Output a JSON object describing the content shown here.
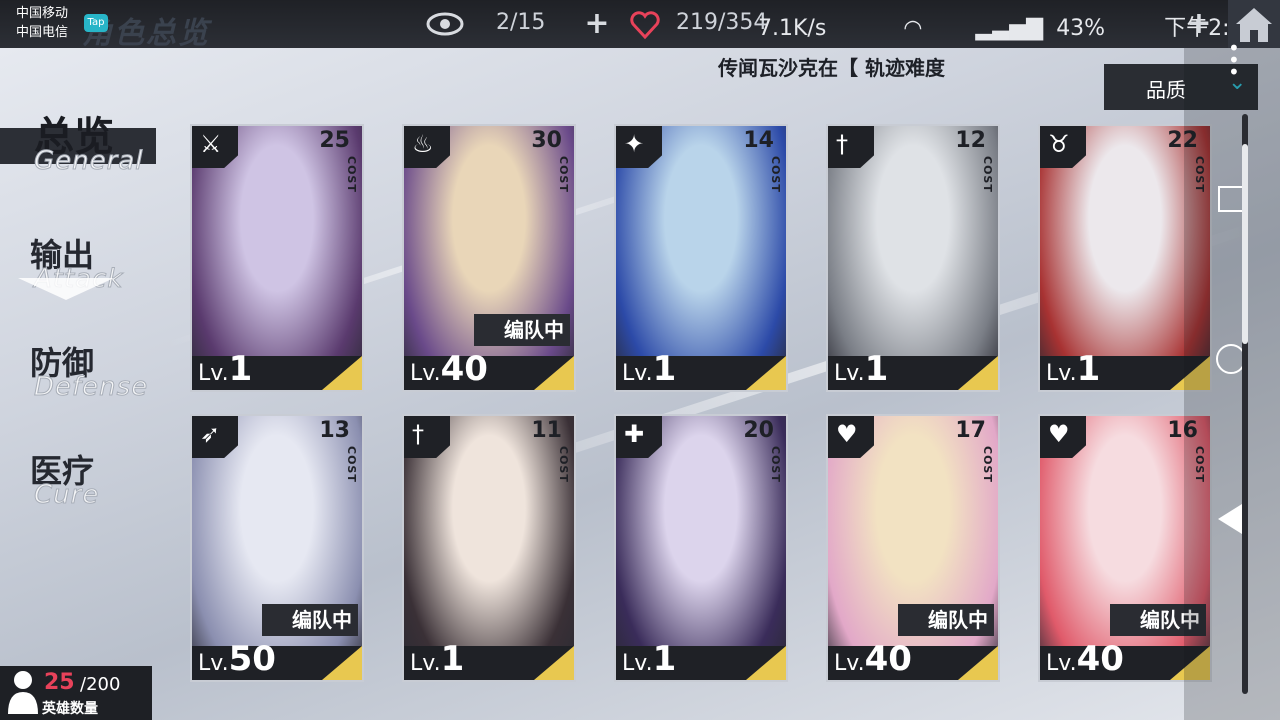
{
  "status_bar": {
    "carrier1": "中国移动",
    "carrier2": "中国电信",
    "tap_badge": "Tap",
    "network_speed": "7.1K/s",
    "battery": "43%",
    "time": "下午2:29"
  },
  "header": {
    "title": "角色总览",
    "page_counter": "2/15",
    "stamina": "219/354",
    "news_ticker": "传闻瓦沙克在【 轨迹难度"
  },
  "filter": {
    "label": "品质"
  },
  "sidebar": {
    "items": [
      {
        "cn": "总览",
        "en": "General",
        "active": true
      },
      {
        "cn": "输出",
        "en": "Attack",
        "active": false
      },
      {
        "cn": "防御",
        "en": "Defense",
        "active": false
      },
      {
        "cn": "医疗",
        "en": "Cure",
        "active": false
      }
    ]
  },
  "hero_count": {
    "current": "25",
    "max": "/200",
    "label": "英雄数量"
  },
  "cost_label": "COST",
  "level_prefix": "Lv.",
  "team_badge_text": "编队中",
  "cards": [
    {
      "cost": "25",
      "level": "1",
      "class": "sword-wings",
      "in_team": false
    },
    {
      "cost": "30",
      "level": "40",
      "class": "flame",
      "in_team": true
    },
    {
      "cost": "14",
      "level": "1",
      "class": "shuriken",
      "in_team": false
    },
    {
      "cost": "12",
      "level": "1",
      "class": "dagger",
      "in_team": false
    },
    {
      "cost": "22",
      "level": "1",
      "class": "demon-horns",
      "in_team": false
    },
    {
      "cost": "13",
      "level": "50",
      "class": "bow",
      "in_team": true
    },
    {
      "cost": "11",
      "level": "1",
      "class": "dagger",
      "in_team": false
    },
    {
      "cost": "20",
      "level": "1",
      "class": "shield",
      "in_team": false
    },
    {
      "cost": "17",
      "level": "40",
      "class": "heart-wings",
      "in_team": true
    },
    {
      "cost": "16",
      "level": "40",
      "class": "heart-wings",
      "in_team": true
    }
  ],
  "colors": {
    "accent_cyan": "#2fc2d6",
    "count_red": "#e8425a",
    "level_stripe": "#e8c850"
  }
}
